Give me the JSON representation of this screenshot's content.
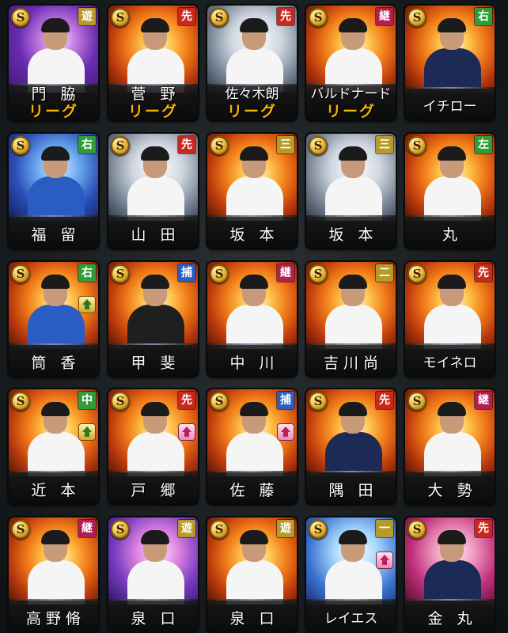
{
  "coin_symbol": "S",
  "position_colors": {
    "遊": "#b69a2a",
    "先": "#c8281e",
    "継": "#b01e55",
    "右": "#2f9e3a",
    "左": "#2f9e3a",
    "中": "#2f9e3a",
    "三": "#b69a2a",
    "二": "#b69a2a",
    "一": "#b69a2a",
    "捕": "#2a5fc0"
  },
  "cards": [
    {
      "name": "門 脇",
      "sub": "リーグ",
      "position": "遊",
      "bg": "purple",
      "uniform": "white",
      "up": null
    },
    {
      "name": "菅 野",
      "sub": "リーグ",
      "position": "先",
      "bg": "fire",
      "uniform": "white",
      "up": null
    },
    {
      "name": "佐々木朗",
      "sub": "リーグ",
      "position": "先",
      "bg": "silver",
      "uniform": "white",
      "up": null
    },
    {
      "name": "バルドナード",
      "sub": "リーグ",
      "position": "継",
      "bg": "fire",
      "uniform": "white",
      "up": null
    },
    {
      "name": "イチロー",
      "sub": "",
      "position": "右",
      "bg": "fire",
      "uniform": "dark",
      "up": null
    },
    {
      "name": "福 留",
      "sub": "",
      "position": "右",
      "bg": "blue",
      "uniform": "blue",
      "up": null
    },
    {
      "name": "山 田",
      "sub": "",
      "position": "先",
      "bg": "silver",
      "uniform": "white",
      "up": null
    },
    {
      "name": "坂 本",
      "sub": "",
      "position": "三",
      "bg": "fire",
      "uniform": "white",
      "up": null
    },
    {
      "name": "坂 本",
      "sub": "",
      "position": "三",
      "bg": "silver",
      "uniform": "white",
      "up": null
    },
    {
      "name": "丸",
      "sub": "",
      "position": "左",
      "bg": "fire",
      "uniform": "white",
      "up": null
    },
    {
      "name": "筒 香",
      "sub": "",
      "position": "右",
      "bg": "fire",
      "uniform": "blue",
      "up": "yellow"
    },
    {
      "name": "甲 斐",
      "sub": "",
      "position": "捕",
      "bg": "fire",
      "uniform": "black",
      "up": null
    },
    {
      "name": "中 川",
      "sub": "",
      "position": "継",
      "bg": "fire",
      "uniform": "white",
      "up": null
    },
    {
      "name": "吉川尚",
      "sub": "",
      "position": "二",
      "bg": "fire",
      "uniform": "white",
      "up": null
    },
    {
      "name": "モイネロ",
      "sub": "",
      "position": "先",
      "bg": "fire",
      "uniform": "white",
      "up": null
    },
    {
      "name": "近 本",
      "sub": "",
      "position": "中",
      "bg": "fire",
      "uniform": "white",
      "up": "yellow"
    },
    {
      "name": "戸 郷",
      "sub": "",
      "position": "先",
      "bg": "fire",
      "uniform": "white",
      "up": "pink"
    },
    {
      "name": "佐 藤",
      "sub": "",
      "position": "捕",
      "bg": "fire",
      "uniform": "white",
      "up": "pink"
    },
    {
      "name": "隅 田",
      "sub": "",
      "position": "先",
      "bg": "fire",
      "uniform": "dark",
      "up": null
    },
    {
      "name": "大 勢",
      "sub": "",
      "position": "継",
      "bg": "fire",
      "uniform": "white",
      "up": null
    },
    {
      "name": "高野脩",
      "sub": "",
      "position": "継",
      "bg": "fire",
      "uniform": "white",
      "up": null
    },
    {
      "name": "泉 口",
      "sub": "",
      "position": "遊",
      "bg": "pink",
      "uniform": "white",
      "up": null
    },
    {
      "name": "泉 口",
      "sub": "",
      "position": "遊",
      "bg": "fire",
      "uniform": "white",
      "up": null
    },
    {
      "name": "レイエス",
      "sub": "",
      "position": "一",
      "bg": "sky",
      "uniform": "white",
      "up": "pink"
    },
    {
      "name": "金 丸",
      "sub": "",
      "position": "先",
      "bg": "rose",
      "uniform": "dark",
      "up": null
    }
  ]
}
